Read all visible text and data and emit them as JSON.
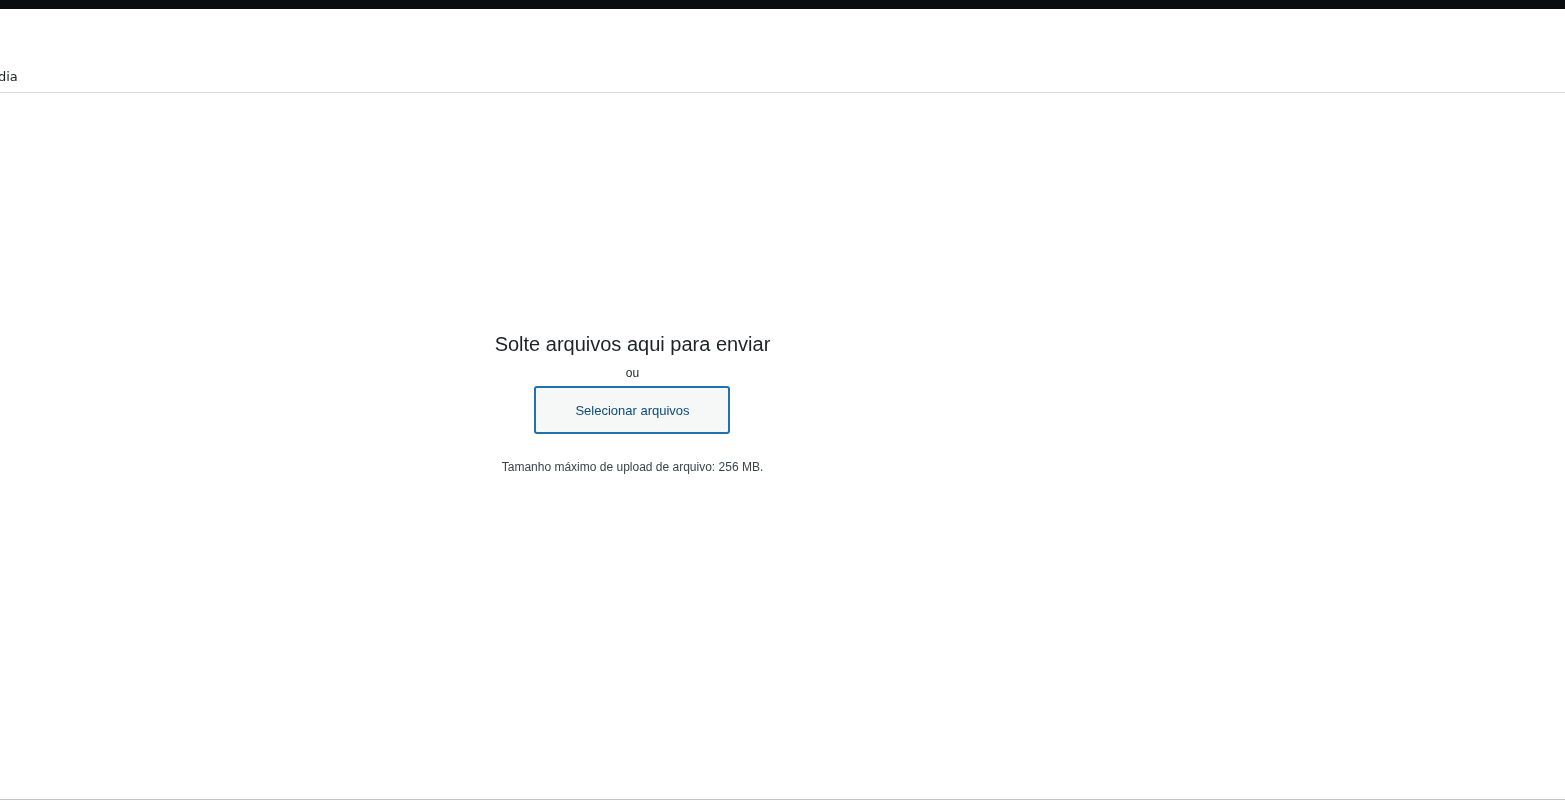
{
  "header": {
    "title": "dia"
  },
  "uploader": {
    "heading": "Solte arquivos aqui para enviar",
    "separator": "ou",
    "button": "Selecionar arquivos",
    "note": "Tamanho máximo de upload de arquivo: 256 MB."
  }
}
